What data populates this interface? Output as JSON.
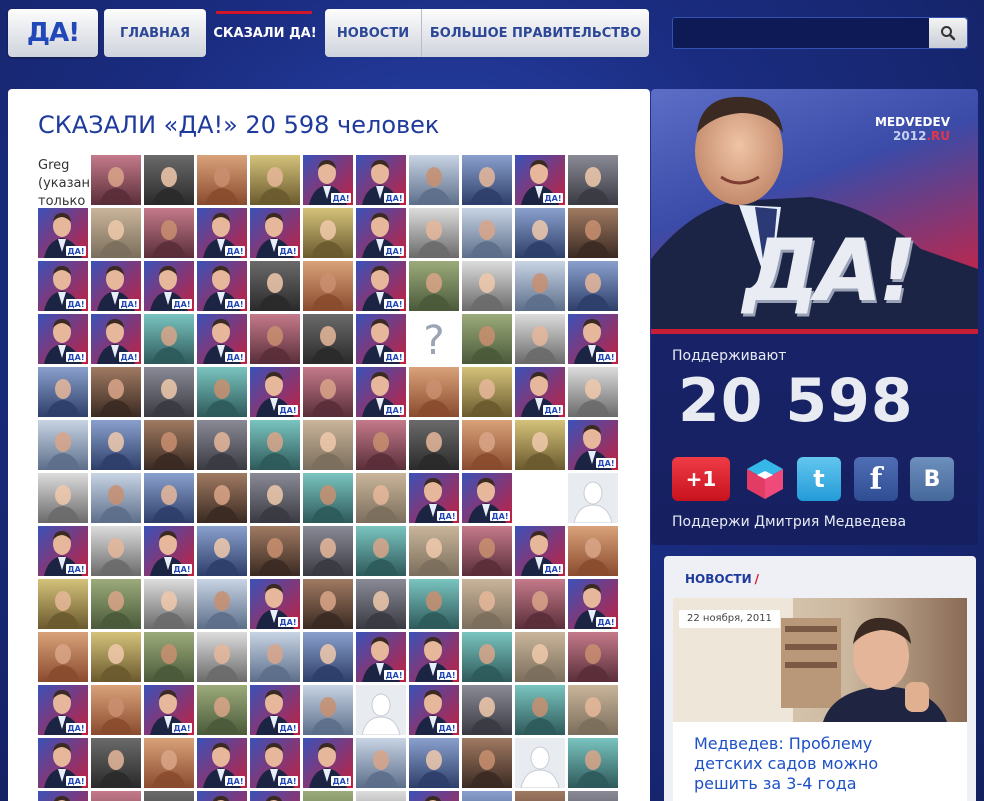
{
  "header": {
    "logo": "ДА!",
    "nav": [
      {
        "label": "ГЛАВНАЯ"
      },
      {
        "label": "СКАЗАЛИ ДА!"
      },
      {
        "label": "НОВОСТИ"
      },
      {
        "label": "БОЛЬШОЕ ПРАВИТЕЛЬСТВО"
      }
    ],
    "search": {
      "value": "",
      "placeholder": ""
    }
  },
  "main": {
    "title": "СКАЗАЛИ «ДА!» 20 598 человек",
    "note": "Greg (указан только"
  },
  "banner": {
    "brand": "MEDVEDEV",
    "brand_year": "2012",
    "brand_tld": ".RU",
    "logo": "ДА!",
    "support_label": "Поддерживают",
    "support_count": "20 598",
    "plus_one": "+1",
    "twitter": "t",
    "facebook": "f",
    "vk": "В",
    "support_line": "Поддержи Дмитрия Медведева"
  },
  "news": {
    "heading": "НОВОСТИ",
    "slash": "/",
    "date": "22 ноября, 2011",
    "headline": "Медведев: Проблему детских садов можно решить за 3-4 года"
  },
  "avatar_grid": {
    "rows": [
      [
        "note",
        "photo",
        "photo",
        "photo",
        "photo",
        "da",
        "da",
        "photo",
        "photo",
        "da",
        "photo"
      ],
      [
        "da",
        "photo",
        "photo",
        "da",
        "da",
        "photo",
        "da",
        "photo",
        "photo",
        "photo",
        "photo"
      ],
      [
        "da",
        "da",
        "da",
        "da",
        "photo",
        "photo",
        "da",
        "photo",
        "photo",
        "photo",
        "photo"
      ],
      [
        "da",
        "da",
        "photo",
        "da",
        "photo",
        "photo",
        "da",
        "question",
        "photo",
        "photo",
        "da"
      ],
      [
        "photo",
        "photo",
        "photo",
        "photo",
        "da",
        "photo",
        "da",
        "photo",
        "photo",
        "da",
        "photo"
      ],
      [
        "photo",
        "photo",
        "photo",
        "photo",
        "photo",
        "photo",
        "photo",
        "photo",
        "photo",
        "photo",
        "da"
      ],
      [
        "photo",
        "photo",
        "photo",
        "photo",
        "photo",
        "photo",
        "photo",
        "da",
        "da",
        "blank",
        "silhouette"
      ],
      [
        "da",
        "photo",
        "da",
        "photo",
        "photo",
        "photo",
        "photo",
        "photo",
        "photo",
        "da",
        "photo"
      ],
      [
        "photo",
        "photo",
        "photo",
        "photo",
        "da",
        "photo",
        "photo",
        "photo",
        "photo",
        "photo",
        "da"
      ],
      [
        "photo",
        "photo",
        "photo",
        "photo",
        "photo",
        "photo",
        "da",
        "da",
        "photo",
        "photo",
        "photo"
      ],
      [
        "da",
        "photo",
        "da",
        "photo",
        "da",
        "photo",
        "silhouette",
        "da",
        "photo",
        "photo",
        "photo"
      ],
      [
        "da",
        "photo",
        "photo",
        "da",
        "da",
        "da",
        "photo",
        "photo",
        "photo",
        "silhouette",
        "photo"
      ],
      [
        "da",
        "photo",
        "photo",
        "da",
        "da",
        "photo",
        "photo",
        "da",
        "photo",
        "photo",
        "photo"
      ]
    ]
  },
  "colors": {
    "background": "#1d2f82",
    "accent_red": "#d2162a",
    "title_blue": "#1e3a9c"
  }
}
